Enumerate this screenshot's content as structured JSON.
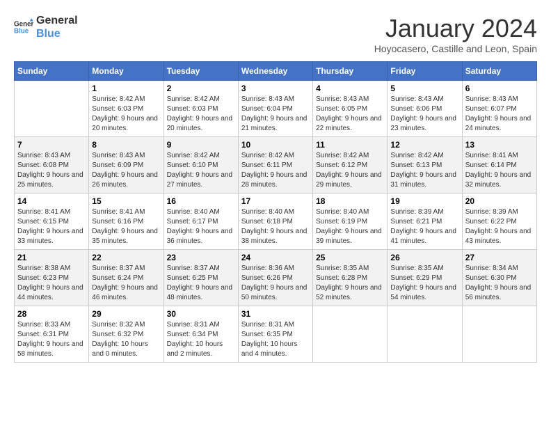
{
  "logo": {
    "line1": "General",
    "line2": "Blue"
  },
  "title": "January 2024",
  "subtitle": "Hoyocasero, Castille and Leon, Spain",
  "headers": [
    "Sunday",
    "Monday",
    "Tuesday",
    "Wednesday",
    "Thursday",
    "Friday",
    "Saturday"
  ],
  "weeks": [
    [
      {
        "day": "",
        "sunrise": "",
        "sunset": "",
        "daylight": ""
      },
      {
        "day": "1",
        "sunrise": "Sunrise: 8:42 AM",
        "sunset": "Sunset: 6:03 PM",
        "daylight": "Daylight: 9 hours and 20 minutes."
      },
      {
        "day": "2",
        "sunrise": "Sunrise: 8:42 AM",
        "sunset": "Sunset: 6:03 PM",
        "daylight": "Daylight: 9 hours and 20 minutes."
      },
      {
        "day": "3",
        "sunrise": "Sunrise: 8:43 AM",
        "sunset": "Sunset: 6:04 PM",
        "daylight": "Daylight: 9 hours and 21 minutes."
      },
      {
        "day": "4",
        "sunrise": "Sunrise: 8:43 AM",
        "sunset": "Sunset: 6:05 PM",
        "daylight": "Daylight: 9 hours and 22 minutes."
      },
      {
        "day": "5",
        "sunrise": "Sunrise: 8:43 AM",
        "sunset": "Sunset: 6:06 PM",
        "daylight": "Daylight: 9 hours and 23 minutes."
      },
      {
        "day": "6",
        "sunrise": "Sunrise: 8:43 AM",
        "sunset": "Sunset: 6:07 PM",
        "daylight": "Daylight: 9 hours and 24 minutes."
      }
    ],
    [
      {
        "day": "7",
        "sunrise": "Sunrise: 8:43 AM",
        "sunset": "Sunset: 6:08 PM",
        "daylight": "Daylight: 9 hours and 25 minutes."
      },
      {
        "day": "8",
        "sunrise": "Sunrise: 8:43 AM",
        "sunset": "Sunset: 6:09 PM",
        "daylight": "Daylight: 9 hours and 26 minutes."
      },
      {
        "day": "9",
        "sunrise": "Sunrise: 8:42 AM",
        "sunset": "Sunset: 6:10 PM",
        "daylight": "Daylight: 9 hours and 27 minutes."
      },
      {
        "day": "10",
        "sunrise": "Sunrise: 8:42 AM",
        "sunset": "Sunset: 6:11 PM",
        "daylight": "Daylight: 9 hours and 28 minutes."
      },
      {
        "day": "11",
        "sunrise": "Sunrise: 8:42 AM",
        "sunset": "Sunset: 6:12 PM",
        "daylight": "Daylight: 9 hours and 29 minutes."
      },
      {
        "day": "12",
        "sunrise": "Sunrise: 8:42 AM",
        "sunset": "Sunset: 6:13 PM",
        "daylight": "Daylight: 9 hours and 31 minutes."
      },
      {
        "day": "13",
        "sunrise": "Sunrise: 8:41 AM",
        "sunset": "Sunset: 6:14 PM",
        "daylight": "Daylight: 9 hours and 32 minutes."
      }
    ],
    [
      {
        "day": "14",
        "sunrise": "Sunrise: 8:41 AM",
        "sunset": "Sunset: 6:15 PM",
        "daylight": "Daylight: 9 hours and 33 minutes."
      },
      {
        "day": "15",
        "sunrise": "Sunrise: 8:41 AM",
        "sunset": "Sunset: 6:16 PM",
        "daylight": "Daylight: 9 hours and 35 minutes."
      },
      {
        "day": "16",
        "sunrise": "Sunrise: 8:40 AM",
        "sunset": "Sunset: 6:17 PM",
        "daylight": "Daylight: 9 hours and 36 minutes."
      },
      {
        "day": "17",
        "sunrise": "Sunrise: 8:40 AM",
        "sunset": "Sunset: 6:18 PM",
        "daylight": "Daylight: 9 hours and 38 minutes."
      },
      {
        "day": "18",
        "sunrise": "Sunrise: 8:40 AM",
        "sunset": "Sunset: 6:19 PM",
        "daylight": "Daylight: 9 hours and 39 minutes."
      },
      {
        "day": "19",
        "sunrise": "Sunrise: 8:39 AM",
        "sunset": "Sunset: 6:21 PM",
        "daylight": "Daylight: 9 hours and 41 minutes."
      },
      {
        "day": "20",
        "sunrise": "Sunrise: 8:39 AM",
        "sunset": "Sunset: 6:22 PM",
        "daylight": "Daylight: 9 hours and 43 minutes."
      }
    ],
    [
      {
        "day": "21",
        "sunrise": "Sunrise: 8:38 AM",
        "sunset": "Sunset: 6:23 PM",
        "daylight": "Daylight: 9 hours and 44 minutes."
      },
      {
        "day": "22",
        "sunrise": "Sunrise: 8:37 AM",
        "sunset": "Sunset: 6:24 PM",
        "daylight": "Daylight: 9 hours and 46 minutes."
      },
      {
        "day": "23",
        "sunrise": "Sunrise: 8:37 AM",
        "sunset": "Sunset: 6:25 PM",
        "daylight": "Daylight: 9 hours and 48 minutes."
      },
      {
        "day": "24",
        "sunrise": "Sunrise: 8:36 AM",
        "sunset": "Sunset: 6:26 PM",
        "daylight": "Daylight: 9 hours and 50 minutes."
      },
      {
        "day": "25",
        "sunrise": "Sunrise: 8:35 AM",
        "sunset": "Sunset: 6:28 PM",
        "daylight": "Daylight: 9 hours and 52 minutes."
      },
      {
        "day": "26",
        "sunrise": "Sunrise: 8:35 AM",
        "sunset": "Sunset: 6:29 PM",
        "daylight": "Daylight: 9 hours and 54 minutes."
      },
      {
        "day": "27",
        "sunrise": "Sunrise: 8:34 AM",
        "sunset": "Sunset: 6:30 PM",
        "daylight": "Daylight: 9 hours and 56 minutes."
      }
    ],
    [
      {
        "day": "28",
        "sunrise": "Sunrise: 8:33 AM",
        "sunset": "Sunset: 6:31 PM",
        "daylight": "Daylight: 9 hours and 58 minutes."
      },
      {
        "day": "29",
        "sunrise": "Sunrise: 8:32 AM",
        "sunset": "Sunset: 6:32 PM",
        "daylight": "Daylight: 10 hours and 0 minutes."
      },
      {
        "day": "30",
        "sunrise": "Sunrise: 8:31 AM",
        "sunset": "Sunset: 6:34 PM",
        "daylight": "Daylight: 10 hours and 2 minutes."
      },
      {
        "day": "31",
        "sunrise": "Sunrise: 8:31 AM",
        "sunset": "Sunset: 6:35 PM",
        "daylight": "Daylight: 10 hours and 4 minutes."
      },
      {
        "day": "",
        "sunrise": "",
        "sunset": "",
        "daylight": ""
      },
      {
        "day": "",
        "sunrise": "",
        "sunset": "",
        "daylight": ""
      },
      {
        "day": "",
        "sunrise": "",
        "sunset": "",
        "daylight": ""
      }
    ]
  ]
}
